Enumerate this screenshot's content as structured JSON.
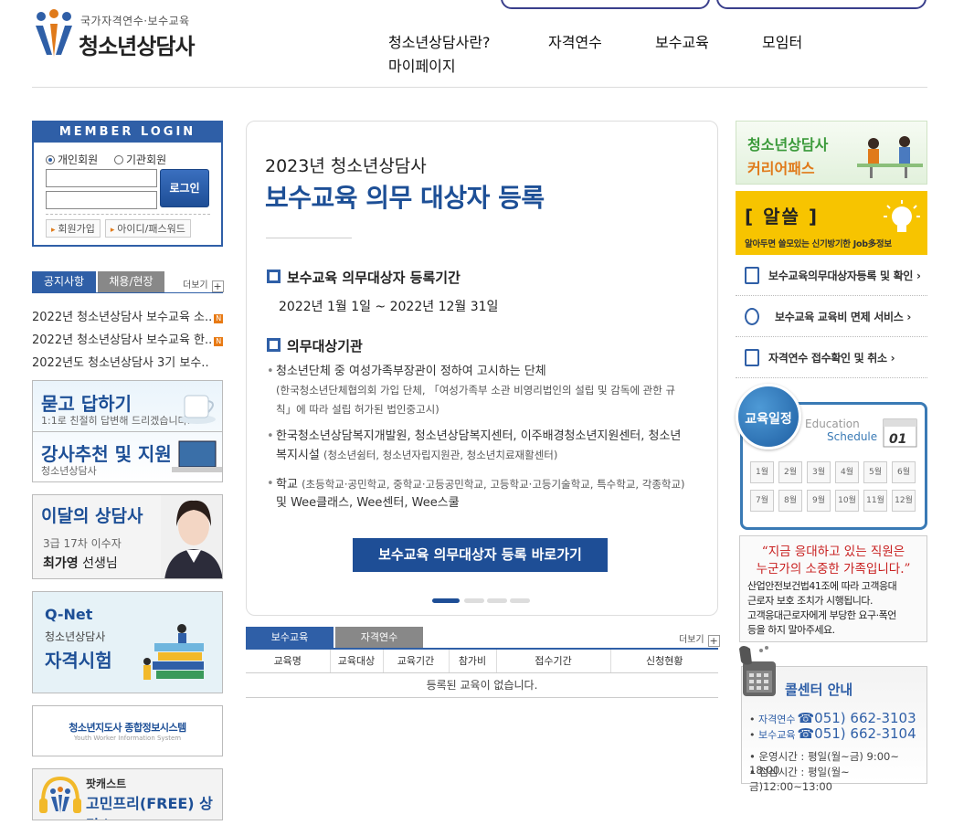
{
  "header": {
    "logo_subtitle": "국가자격연수·보수교육",
    "logo_title": "청소년상담사",
    "nav": [
      "청소년상담사란?",
      "자격연수",
      "보수교육",
      "모임터",
      "마이페이지"
    ]
  },
  "login": {
    "heading": "MEMBER LOGIN",
    "radio_personal": "개인회원",
    "radio_org": "기관회원",
    "button": "로그인",
    "join": "회원가입",
    "find": "아이디/패스워드"
  },
  "notice": {
    "tabs": [
      "공지사항",
      "채용/현장"
    ],
    "more": "더보기",
    "items": [
      {
        "title": "2022년 청소년상담사 보수교육 소..",
        "badge": "N"
      },
      {
        "title": "2022년 청소년상담사 보수교육 한..",
        "badge": "N"
      },
      {
        "title": "2022년도 청소년상담사 3기 보수..",
        "badge": ""
      }
    ]
  },
  "banners": {
    "qa_title": "묻고 답하기",
    "qa_desc": "1:1로 친절히 답변해 드리겠습니다.",
    "lecturer_title": "강사추천 및 지원",
    "lecturer_desc": "청소년상담사",
    "month_title": "이달의 상담사",
    "month_level": "3급 17차 이수자",
    "month_name": "최가영",
    "month_suffix": "선생님",
    "qnet_logo": "Q-Net",
    "qnet_sub": "청소년상담사",
    "qnet_title": "자격시험",
    "sys_title": "청소년지도사 종합정보시스템",
    "sys_en": "Youth Worker Information System",
    "pod_title": "팟캐스트",
    "pod_main": "고민프리(FREE) 상담소"
  },
  "main": {
    "year": "2023년 청소년상담사",
    "title": "보수교육 의무 대상자 등록",
    "sec1_title": "보수교육 의무대상자 등록기간",
    "sec1_date": "2022년 1월 1일 ~ 2022년 12월 31일",
    "sec2_title": "의무대상기관",
    "item1": "청소년단체 중 여성가족부장관이 정하여 고시하는 단체",
    "item1_note": "(한국청소년단체협의회 가입 단체, 「여성가족부 소관 비영리법인의 설립 및 감독에 관한 규칙」에 따라 설립 허가된 법인중고시)",
    "item2": "한국청소년상담복지개발원, 청소년상담복지센터, 이주배경청소년지원센터, 청소년복지시설",
    "item2_note": "(청소년쉼터, 청소년자립지원관, 청소년치료재활센터)",
    "item3": "학교",
    "item3_note": "(초등학교·공민학교, 중학교·고등공민학교, 고등학교·고등기술학교, 특수학교, 각종학교)",
    "item3_tail": "및 Wee클래스, Wee센터, Wee스쿨",
    "button": "보수교육 의무대상자 등록 바로가기"
  },
  "edu": {
    "tabs": [
      "보수교육",
      "자격연수"
    ],
    "more": "더보기",
    "columns": [
      "교육명",
      "교육대상",
      "교육기간",
      "참가비",
      "접수기간",
      "신청현황"
    ],
    "empty": "등록된 교육이 없습니다."
  },
  "right": {
    "career_line1": "청소년상담사",
    "career_line2": "커리어패스",
    "al_title": "[ 알쓸          ]",
    "al_desc": "알아두면 쓸모있는 신기방기한 Job多정보",
    "links": [
      "보수교육의무대상자등록 및 확인 ›",
      "보수교육 교육비 면제 서비스 ›",
      "자격연수 접수확인 및 취소 ›"
    ],
    "sched_badge": "교육일정",
    "sched_en1": "Education",
    "sched_en2": "Schedule",
    "months": [
      "1월",
      "2월",
      "3월",
      "4월",
      "5월",
      "6월",
      "7월",
      "8월",
      "9월",
      "10월",
      "11월",
      "12월"
    ],
    "notice_quote1": "“지금 응대하고 있는 직원은",
    "notice_quote2": "누군가의 소중한 가족입니다.”",
    "notice_desc1": "산업안전보건법41조에 따라 고객응대",
    "notice_desc2": "근로자 보호 조치가 시행됩니다.",
    "notice_desc3": "고객응대근로자에게 부당한 요구·폭언",
    "notice_desc4": "등을 하지 말아주세요.",
    "call_title": "콜센터 안내",
    "call_label1": "자격연수",
    "call_phone1": "☎051) 662-3103",
    "call_label2": "보수교육",
    "call_phone2": "☎051) 662-3104",
    "call_hours": "운영시간 : 평일(월~금) 9:00~ 18:00",
    "call_lunch": "점심시간 : 평일(월~금)12:00~13:00"
  }
}
